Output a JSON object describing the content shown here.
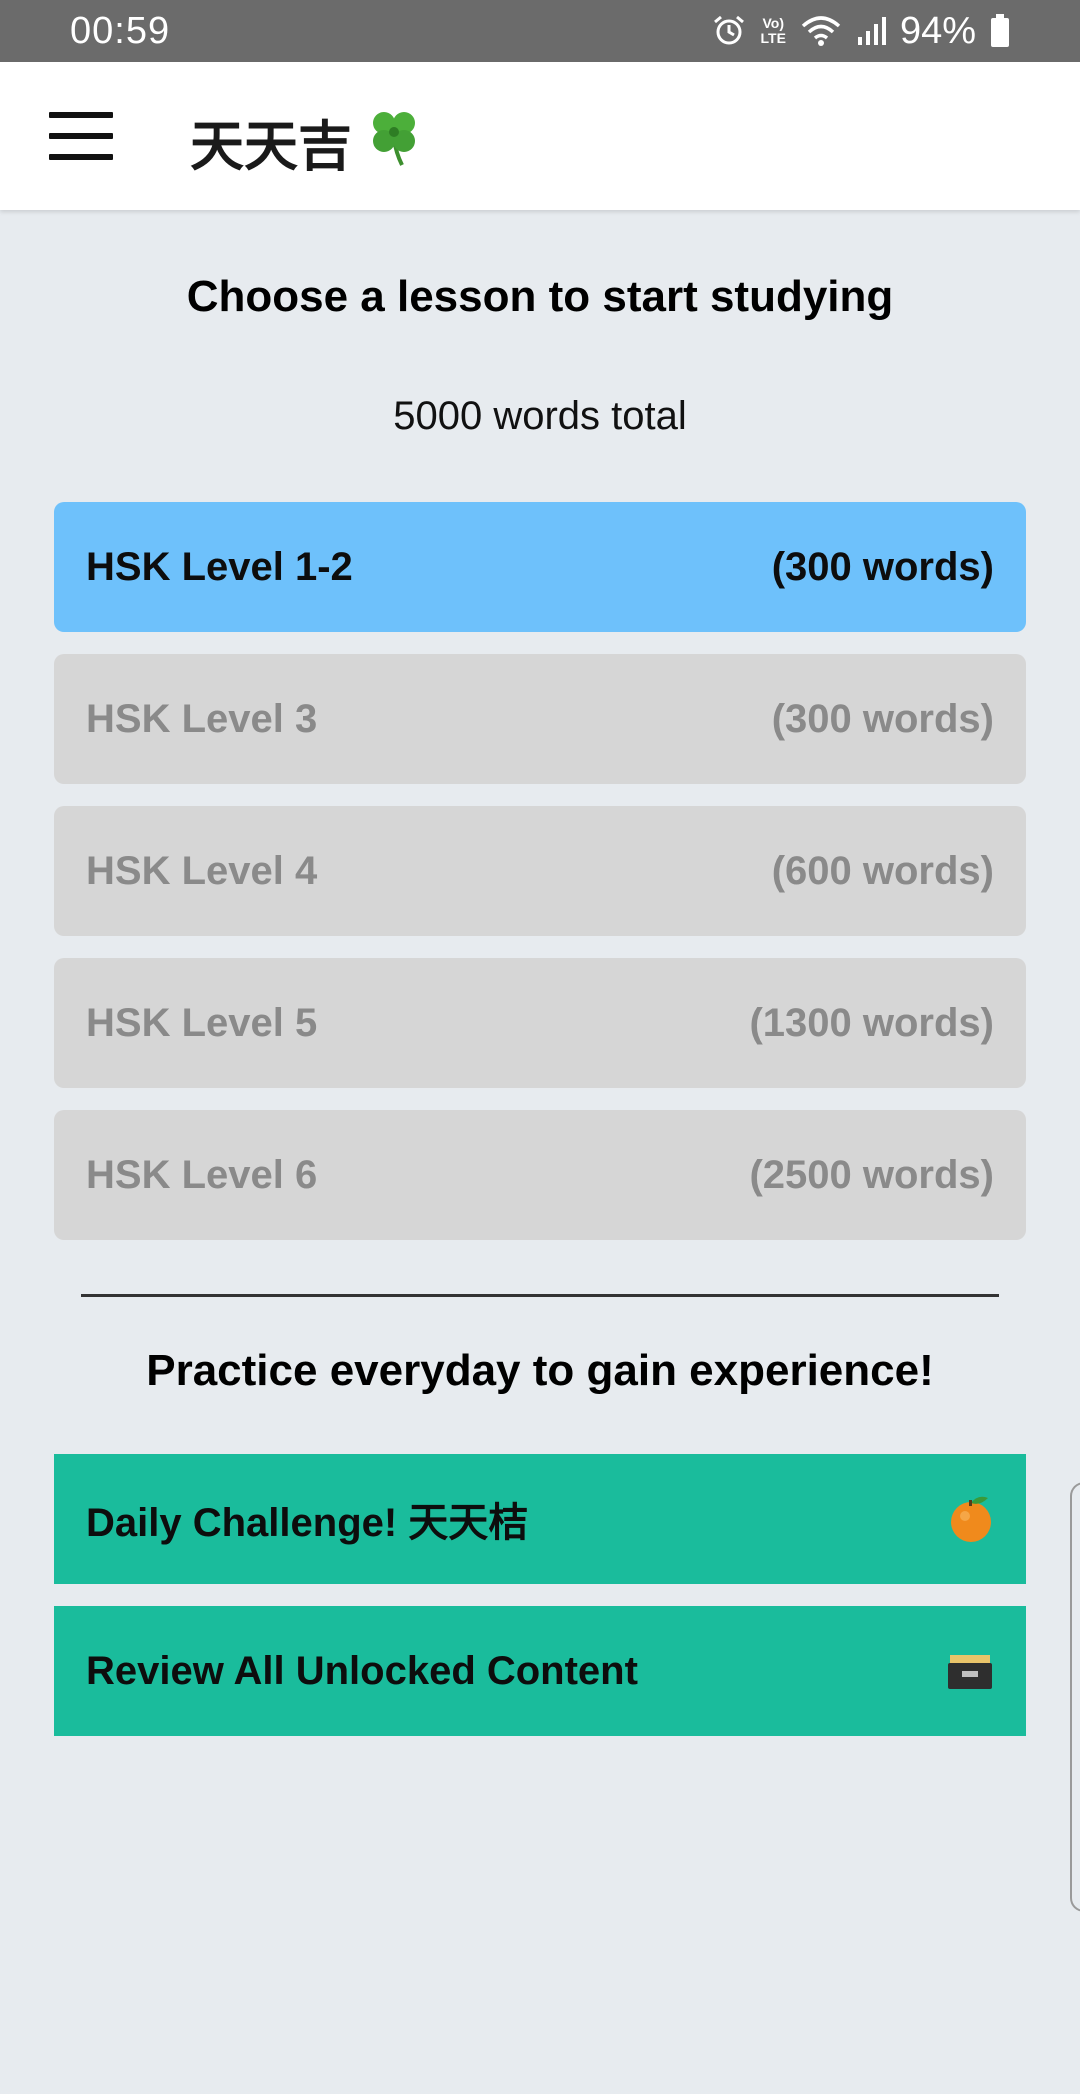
{
  "status_bar": {
    "time": "00:59",
    "battery": "94%",
    "network_label_top": "Vo)",
    "network_label_bottom": "LTE"
  },
  "app_bar": {
    "title": "天天吉",
    "title_icon": "four-leaf-clover-icon",
    "menu_icon": "hamburger-menu-icon"
  },
  "main": {
    "heading": "Choose a lesson to start studying",
    "total_words": "5000 words total",
    "lessons": [
      {
        "label": "HSK Level 1-2",
        "count": "(300 words)",
        "state": "unlocked"
      },
      {
        "label": "HSK Level 3",
        "count": "(300 words)",
        "state": "locked"
      },
      {
        "label": "HSK Level 4",
        "count": "(600 words)",
        "state": "locked"
      },
      {
        "label": "HSK Level 5",
        "count": "(1300 words)",
        "state": "locked"
      },
      {
        "label": "HSK Level 6",
        "count": "(2500 words)",
        "state": "locked"
      }
    ],
    "practice_heading": "Practice everyday to gain experience!",
    "actions": [
      {
        "label": "Daily Challenge! 天天桔",
        "icon": "tangerine-icon"
      },
      {
        "label": "Review All Unlocked Content",
        "icon": "card-file-box-icon"
      }
    ]
  },
  "colors": {
    "background": "#e7ebef",
    "active_lesson": "#6ec1fb",
    "locked_lesson": "#d6d6d6",
    "action": "#1abc9c",
    "status_bar": "#6b6b6b"
  }
}
